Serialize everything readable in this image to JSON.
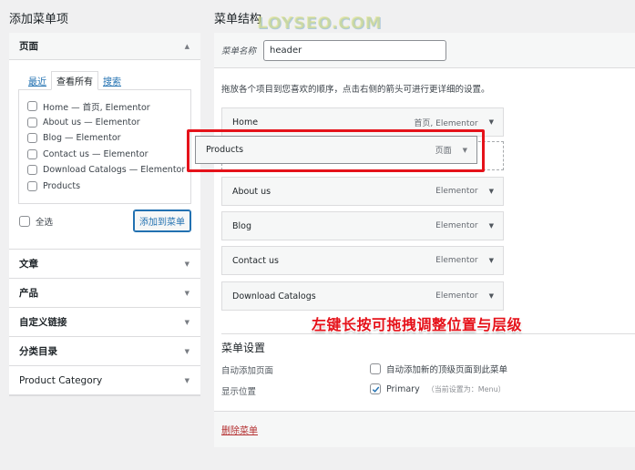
{
  "left": {
    "title": "添加菜单项",
    "pages_section": {
      "label": "页面",
      "tabs": [
        "最近",
        "查看所有",
        "搜索"
      ],
      "active_tab": "查看所有",
      "items": [
        {
          "label": "Home — 首页, Elementor",
          "checked": false
        },
        {
          "label": "About us — Elementor",
          "checked": false
        },
        {
          "label": "Blog — Elementor",
          "checked": false
        },
        {
          "label": "Contact us — Elementor",
          "checked": false
        },
        {
          "label": "Download Catalogs — Elementor",
          "checked": false
        },
        {
          "label": "Products",
          "checked": false
        }
      ],
      "select_all_label": "全选",
      "add_button_label": "添加到菜单"
    },
    "sections": [
      {
        "label": "文章"
      },
      {
        "label": "产品"
      },
      {
        "label": "自定义链接"
      },
      {
        "label": "分类目录"
      },
      {
        "label": "Product Category"
      }
    ]
  },
  "right": {
    "title": "菜单结构",
    "menu_name_label": "菜单名称",
    "menu_name_value": "header",
    "hint": "拖放各个项目到您喜欢的顺序，点击右侧的箭头可进行更详细的设置。",
    "menu_items": [
      {
        "title": "Home",
        "type": "首页, Elementor"
      },
      {
        "title": "About us",
        "type": "Elementor"
      },
      {
        "title": "Blog",
        "type": "Elementor"
      },
      {
        "title": "Contact us",
        "type": "Elementor"
      },
      {
        "title": "Download Catalogs",
        "type": "Elementor"
      }
    ],
    "dragging_item": {
      "title": "Products",
      "type": "页面"
    },
    "settings": {
      "title": "菜单设置",
      "auto_add_label": "自动添加页面",
      "auto_add_option": "自动添加新的顶级页面到此菜单",
      "auto_add_checked": false,
      "location_label": "显示位置",
      "location_option": "Primary",
      "location_note": "（当前设置为：Menu）",
      "location_checked": true
    },
    "delete_link": "删除菜单"
  },
  "annotation": "左键长按可拖拽调整位置与层级",
  "watermark": "LOYSEO.COM",
  "colors": {
    "accent": "#2271b1",
    "annotation_red": "#e5121a",
    "delete_red": "#b32d2e"
  }
}
